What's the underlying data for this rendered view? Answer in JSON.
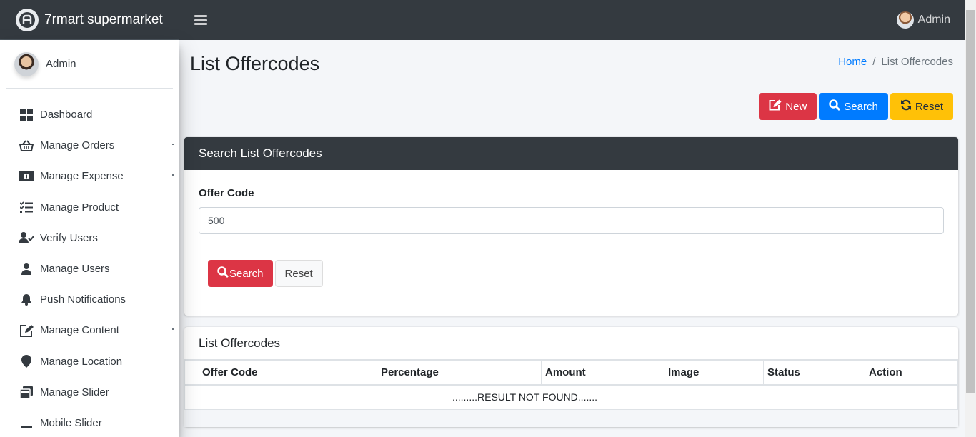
{
  "app": {
    "brand": "7rmart supermarket"
  },
  "navbar": {
    "user": "Admin"
  },
  "sidebar": {
    "user": "Admin",
    "items": [
      {
        "label": "Dashboard",
        "icon": "dashboard-icon"
      },
      {
        "label": "Manage Orders",
        "icon": "basket-icon"
      },
      {
        "label": "Manage Expense",
        "icon": "money-icon"
      },
      {
        "label": "Manage Product",
        "icon": "tasks-icon"
      },
      {
        "label": "Verify Users",
        "icon": "user-check-icon"
      },
      {
        "label": "Manage Users",
        "icon": "user-icon"
      },
      {
        "label": "Push Notifications",
        "icon": "bell-icon"
      },
      {
        "label": "Manage Content",
        "icon": "edit-icon"
      },
      {
        "label": "Manage Location",
        "icon": "map-marker-icon"
      },
      {
        "label": "Manage Slider",
        "icon": "slider-icon"
      },
      {
        "label": "Mobile Slider",
        "icon": "minus-icon"
      }
    ]
  },
  "page": {
    "title": "List Offercodes",
    "breadcrumb": {
      "home": "Home",
      "separator": "/",
      "current": "List Offercodes"
    }
  },
  "toolbar": {
    "new": "New",
    "search": "Search",
    "reset": "Reset"
  },
  "search_card": {
    "title": "Search List Offercodes",
    "field_label": "Offer Code",
    "field_value": "500",
    "search_button": "Search",
    "reset_button": "Reset"
  },
  "list_card": {
    "title": "List Offercodes",
    "columns": [
      "Offer Code",
      "Percentage",
      "Amount",
      "Image",
      "Status",
      "Action"
    ],
    "empty_message": ".........RESULT NOT FOUND......."
  },
  "colors": {
    "danger": "#dc3545",
    "primary": "#007bff",
    "warning": "#ffc107",
    "dark": "#343a40"
  }
}
